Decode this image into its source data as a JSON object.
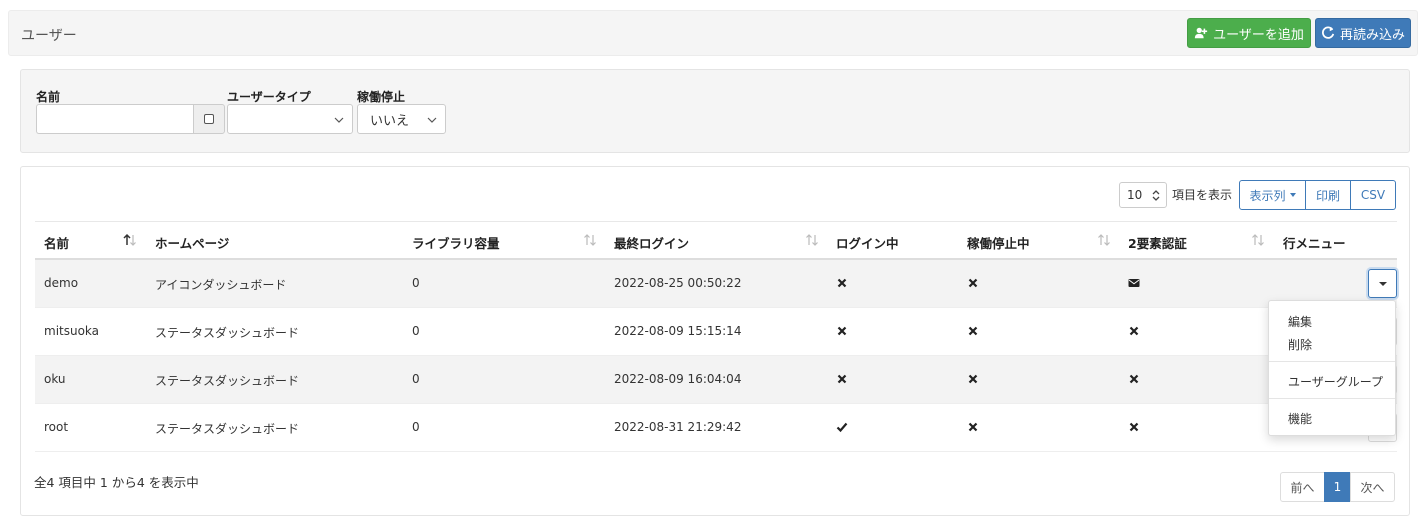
{
  "header": {
    "title": "ユーザー",
    "add_button": "ユーザーを追加",
    "reload_button": "再読み込み"
  },
  "filters": {
    "name_label": "名前",
    "name_value": "",
    "type_label": "ユーザータイプ",
    "type_value": "",
    "stopped_label": "稼働停止",
    "stopped_value": "いいえ"
  },
  "toolbar": {
    "page_size": "10",
    "page_size_label": "項目を表示",
    "columns_button": "表示列",
    "print_button": "印刷",
    "csv_button": "CSV"
  },
  "table": {
    "headers": [
      "名前",
      "ホームページ",
      "ライブラリ容量",
      "最終ログイン",
      "ログイン中",
      "稼働停止中",
      "2要素認証",
      "行メニュー"
    ],
    "rows": [
      {
        "name": "demo",
        "homepage": "アイコンダッシュボード",
        "library": "0",
        "last_login": "2022-08-25 00:50:22",
        "logged_in": "cross",
        "stopped": "cross",
        "twofa": "envelope"
      },
      {
        "name": "mitsuoka",
        "homepage": "ステータスダッシュボード",
        "library": "0",
        "last_login": "2022-08-09 15:15:14",
        "logged_in": "cross",
        "stopped": "cross",
        "twofa": "cross"
      },
      {
        "name": "oku",
        "homepage": "ステータスダッシュボード",
        "library": "0",
        "last_login": "2022-08-09 16:04:04",
        "logged_in": "cross",
        "stopped": "cross",
        "twofa": "cross"
      },
      {
        "name": "root",
        "homepage": "ステータスダッシュボード",
        "library": "0",
        "last_login": "2022-08-31 21:29:42",
        "logged_in": "check",
        "stopped": "cross",
        "twofa": "cross"
      }
    ]
  },
  "row_menu": {
    "edit": "編集",
    "delete": "削除",
    "user_group": "ユーザーグループ",
    "features": "機能"
  },
  "footer": {
    "summary": "全4 項目中 1 から4 を表示中",
    "prev": "前へ",
    "current_page": "1",
    "next": "次へ"
  },
  "colors": {
    "primary": "#3f7ab8",
    "success": "#4cae4c"
  }
}
